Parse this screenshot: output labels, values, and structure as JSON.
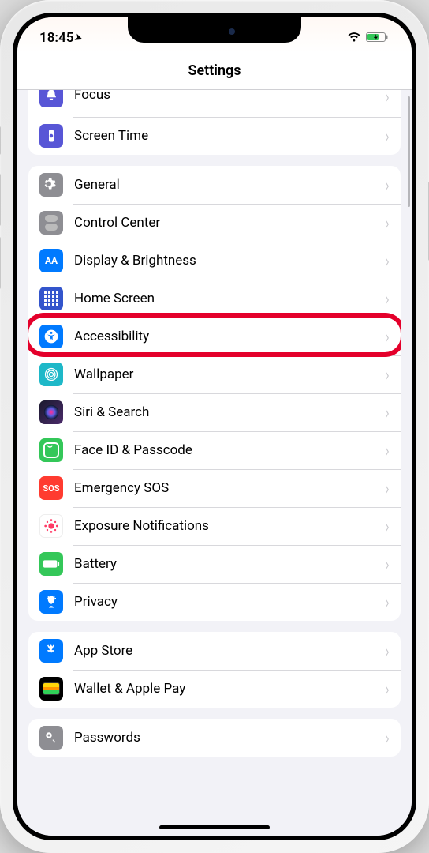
{
  "status": {
    "time": "18:45"
  },
  "nav": {
    "title": "Settings"
  },
  "group0": {
    "focus": "Focus",
    "screentime": "Screen Time"
  },
  "group1": {
    "general": "General",
    "controlcenter": "Control Center",
    "display": "Display & Brightness",
    "homescreen": "Home Screen",
    "accessibility": "Accessibility",
    "wallpaper": "Wallpaper",
    "siri": "Siri & Search",
    "faceid": "Face ID & Passcode",
    "sos": "Emergency SOS",
    "exposure": "Exposure Notifications",
    "battery": "Battery",
    "privacy": "Privacy"
  },
  "group2": {
    "appstore": "App Store",
    "wallet": "Wallet & Apple Pay"
  },
  "group3": {
    "passwords": "Passwords"
  },
  "icons": {
    "display_text": "AA",
    "sos_text": "SOS"
  }
}
